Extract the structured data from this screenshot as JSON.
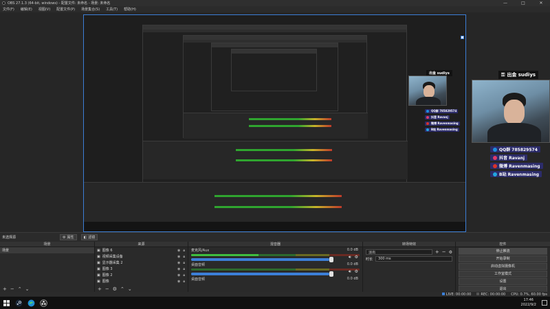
{
  "window": {
    "title": "OBS 27.1.3 (64-bit, windows) - 配置文件: 未命名 - 场景: 未命名",
    "controls": {
      "minimize": "—",
      "maximize": "□",
      "close": "✕"
    }
  },
  "menu": [
    "文件(F)",
    "编辑(E)",
    "视图(V)",
    "配置文件(P)",
    "场景集合(S)",
    "工具(T)",
    "帮助(H)"
  ],
  "overlay_large": {
    "title": "出金 sudiys",
    "socials": [
      {
        "label": "QQ群  785829574",
        "color": "#1c8fe0"
      },
      {
        "label": "抖音  Ravanj",
        "color": "#e03c6a"
      },
      {
        "label": "微博  Ravenmasing",
        "color": "#d9322a"
      },
      {
        "label": "B站  Ravenmasing",
        "color": "#22a6e0"
      }
    ]
  },
  "overlay_medium": {
    "title": "出金 sudiys"
  },
  "scene_bar": {
    "label": "未选择源",
    "properties_button": "属性",
    "filters_button": "滤镜"
  },
  "docks": {
    "scenes": {
      "title": "场景",
      "items": [
        "场景"
      ]
    },
    "sources": {
      "title": "来源",
      "items": [
        "图像 6",
        "视频采集设备",
        "显示器采集 2",
        "图像 3",
        "图像 2",
        "图像"
      ]
    },
    "mixer": {
      "title": "混音器",
      "tracks": [
        {
          "name": "麦克风/Aux",
          "db": "0.0 dB",
          "level": 0.4
        },
        {
          "name": "桌面音频",
          "db": "0.0 dB",
          "level": 0.0
        },
        {
          "name": "桌面音频",
          "db": "0.0 dB",
          "level": 0.0
        }
      ]
    },
    "transitions": {
      "title": "转场特效",
      "type": "淡出",
      "duration_label": "时长",
      "duration_value": "300 ms"
    },
    "controls": {
      "title": "控件",
      "buttons": [
        "停止推流",
        "开始录制",
        "启动虚拟摄像机",
        "工作室模式",
        "设置",
        "退出"
      ]
    }
  },
  "statusbar": {
    "live": "LIVE: 00:00:00",
    "rec": "REC: 00:00:00",
    "cpu": "CPU: 0.7%, 60.00 fps"
  },
  "taskbar": {
    "time": "17:46",
    "date": "2022/9/2"
  },
  "colors": {
    "accent": "#3c7fd8",
    "social_bg": "#2c2c6a"
  }
}
